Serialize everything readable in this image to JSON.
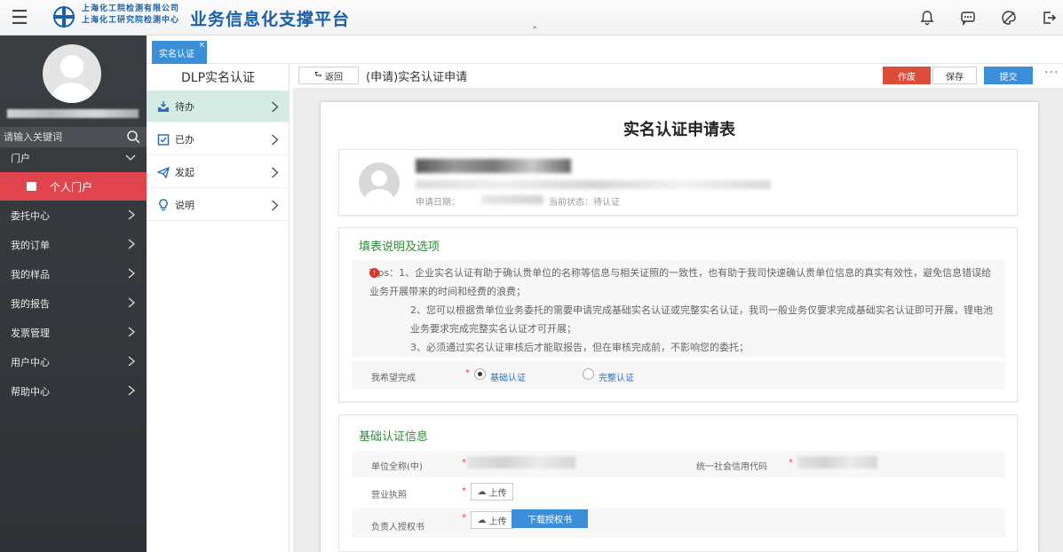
{
  "header": {
    "org_line1": "上海化工院检测有限公司",
    "org_line2": "上海化工研究院检测中心",
    "brand": "业务信息化支撑平台",
    "icons": [
      "menu-icon",
      "bell-icon",
      "message-icon",
      "palette-icon",
      "logout-icon"
    ]
  },
  "sidebar": {
    "search_placeholder": "请输入关键词",
    "portal_label": "门户",
    "portal_sub_label": "个人门户",
    "items": [
      {
        "label": "委托中心"
      },
      {
        "label": "我的订单"
      },
      {
        "label": "我的样品"
      },
      {
        "label": "我的报告"
      },
      {
        "label": "发票管理"
      },
      {
        "label": "用户中心"
      },
      {
        "label": "帮助中心"
      }
    ]
  },
  "tabs": {
    "active": "实名认证",
    "close": "×"
  },
  "subnav": {
    "title": "DLP实名认证",
    "items": [
      {
        "label": "待办"
      },
      {
        "label": "已办"
      },
      {
        "label": "发起"
      },
      {
        "label": "说明"
      }
    ]
  },
  "toolbar": {
    "back": "返回",
    "page_title": "(申请)实名认证申请",
    "void": "作废",
    "save": "保存",
    "submit": "提交",
    "more": "···"
  },
  "form": {
    "title": "实名认证申请表",
    "applicant": {
      "date_label": "申请日期：",
      "status": "当前状态：待认证"
    },
    "notes_title": "填表说明及选项",
    "tips": [
      "Tips：1、企业实名认证有助于确认贵单位的名称等信息与相关证照的一致性，也有助于我司快速确认贵单位信息的真实有效性，避免信息错误给业务开展带来的时间和经费的浪费；",
      "2、您可以根据贵单位业务委托的需要申请完成基础实名认证或完整实名认证，我司一般业务仅要求完成基础实名认证即可开展，锂电池业务要求完成完整实名认证才可开展；",
      "3、必须通过实名认证审核后才能取报告，但在审核完成前，不影响您的委托；"
    ],
    "choose_label": "我希望完成",
    "required_mark": "*",
    "options": [
      {
        "label": "基础认证",
        "selected": true
      },
      {
        "label": "完整认证",
        "selected": false
      }
    ],
    "basic_title": "基础认证信息",
    "fields": {
      "company_name": "单位全称(中)",
      "credit_code": "统一社会信用代码",
      "license": "营业执照",
      "authorization": "负责人授权书"
    },
    "upload_label": "上传",
    "download_label": "下载授权书"
  },
  "colors": {
    "primary": "#3b8fd9",
    "danger": "#dd4b39",
    "sidebar_active": "#e0454d",
    "section_title": "#2f8a3c"
  }
}
